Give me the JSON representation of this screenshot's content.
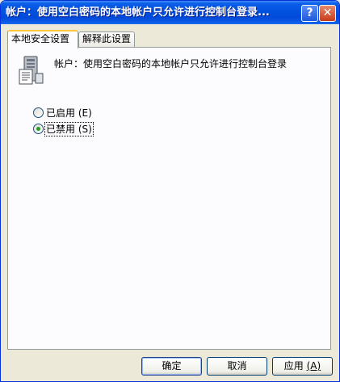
{
  "window": {
    "title": "帐户：使用空白密码的本地帐户只允许进行控制台登录...",
    "help_glyph": "?",
    "close_glyph": "✕"
  },
  "tabs": [
    {
      "label": "本地安全设置",
      "active": true
    },
    {
      "label": "解释此设置",
      "active": false
    }
  ],
  "policy": {
    "icon": "computer-policy-icon",
    "description": "帐户：使用空白密码的本地帐户只允许进行控制台登录"
  },
  "options": [
    {
      "label": "已启用",
      "hotkey": "(E)",
      "selected": false
    },
    {
      "label": "已禁用",
      "hotkey": "(S)",
      "selected": true
    }
  ],
  "buttons": {
    "ok": "确定",
    "cancel": "取消",
    "apply": "应用",
    "apply_hotkey": "(A)"
  },
  "colors": {
    "titlebar": "#0352e0",
    "face": "#ece9d8",
    "tab_highlight": "#ffc83c",
    "radio_dot": "#21a121"
  }
}
